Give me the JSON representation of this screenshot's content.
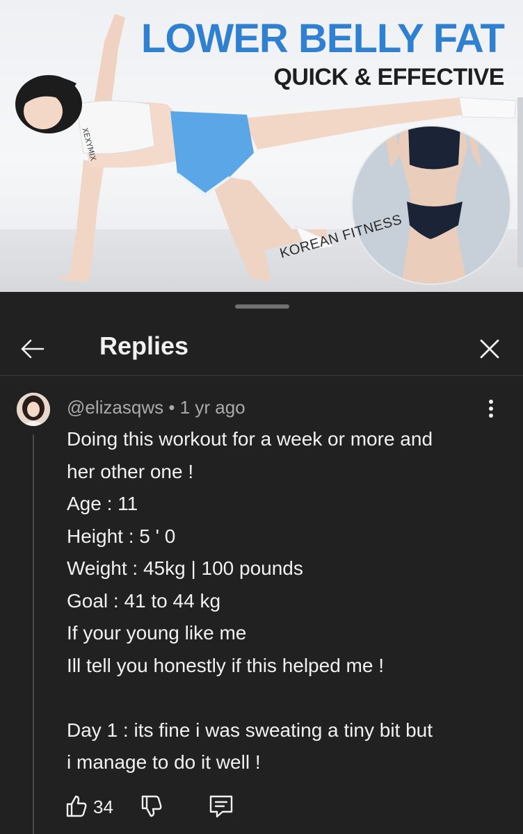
{
  "thumbnail": {
    "title": "LOWER BELLY FAT",
    "subtitle": "QUICK & EFFECTIVE",
    "brand_label": "KOREAN FITNESS",
    "shirt_text": "XEXYMIX",
    "colors": {
      "title": "#2f80d0",
      "shorts": "#5aa6e6"
    }
  },
  "panel": {
    "title": "Replies",
    "back_icon": "arrow-left-icon",
    "close_icon": "close-icon"
  },
  "comment": {
    "author": "@elizasqws",
    "separator": " • ",
    "time": "1 yr ago",
    "text": "Doing this workout for a week or more and\nher other one !\nAge : 11\nHeight : 5 ' 0\nWeight : 45kg | 100 pounds\nGoal : 41 to 44 kg\nIf your young like me\nIll tell you honestly if this helped me !\n\nDay 1 : its fine i was sweating a tiny bit but\ni manage to do it well !",
    "likes": "34",
    "icons": [
      "thumbs-up-icon",
      "thumbs-down-icon",
      "reply-icon",
      "more-vert-icon"
    ]
  }
}
